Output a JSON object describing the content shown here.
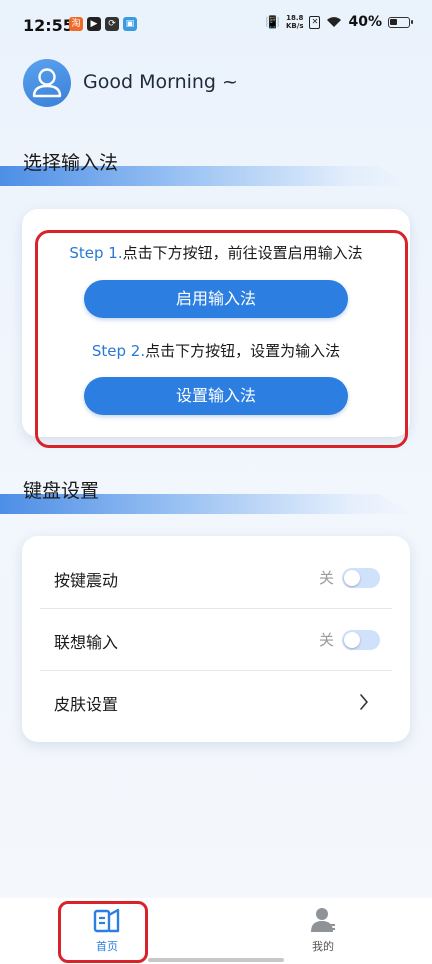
{
  "status_bar": {
    "time": "12:55",
    "net_speed_value": "18.8",
    "net_speed_unit": "KB/s",
    "battery_percent": "40%",
    "battery_level": 0.4
  },
  "header": {
    "greeting": "Good Morning ~"
  },
  "section_input_method": {
    "title": "选择输入法",
    "step1_num": "Step 1.",
    "step1_text": "点击下方按钮，前往设置启用输入法",
    "enable_button": "启用输入法",
    "step2_num": "Step 2.",
    "step2_text": "点击下方按钮，设置为输入法",
    "set_button": "设置输入法"
  },
  "section_keyboard": {
    "title": "键盘设置",
    "rows": [
      {
        "label": "按键震动",
        "state": "关",
        "enabled": false
      },
      {
        "label": "联想输入",
        "state": "关",
        "enabled": false
      },
      {
        "label": "皮肤设置"
      }
    ]
  },
  "bottom_nav": {
    "items": [
      {
        "label": "首页",
        "active": true
      },
      {
        "label": "我的",
        "active": false
      }
    ]
  },
  "colors": {
    "accent": "#2c7fe0",
    "highlight": "#d8232a"
  }
}
